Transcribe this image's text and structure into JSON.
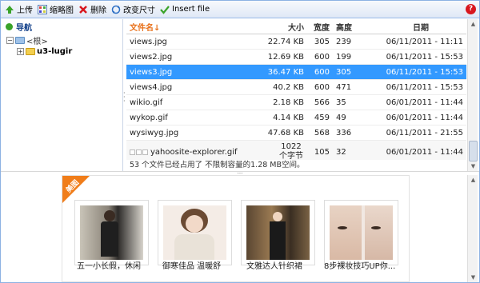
{
  "toolbar": {
    "items": [
      {
        "label": "上传",
        "icon": "upload-icon"
      },
      {
        "label": "缩略图",
        "icon": "thumbnail-icon"
      },
      {
        "label": "删除",
        "icon": "delete-icon"
      },
      {
        "label": "改变尺寸",
        "icon": "resize-icon"
      },
      {
        "label": "Insert file",
        "icon": "insert-file-icon"
      }
    ],
    "help_label": "?"
  },
  "nav": {
    "title": "导航",
    "tree": [
      {
        "label": "<根>",
        "toggle": "⊟"
      },
      {
        "label": "u3-lugir",
        "toggle": "⊞"
      }
    ]
  },
  "grid": {
    "headers": {
      "name": "文件名↓",
      "size": "大小",
      "width": "宽度",
      "height": "高度",
      "date": "日期"
    },
    "rows": [
      {
        "name": "views.jpg",
        "size": "22.74 KB",
        "w": "305",
        "h": "239",
        "date": "06/11/2011 - 11:11"
      },
      {
        "name": "views2.jpg",
        "size": "12.69 KB",
        "w": "600",
        "h": "199",
        "date": "06/11/2011 - 15:53"
      },
      {
        "name": "views3.jpg",
        "size": "36.47 KB",
        "w": "600",
        "h": "305",
        "date": "06/11/2011 - 15:53"
      },
      {
        "name": "views4.jpg",
        "size": "40.2 KB",
        "w": "600",
        "h": "471",
        "date": "06/11/2011 - 15:53"
      },
      {
        "name": "wikio.gif",
        "size": "2.18 KB",
        "w": "566",
        "h": "35",
        "date": "06/01/2011 - 11:44"
      },
      {
        "name": "wykop.gif",
        "size": "4.14 KB",
        "w": "459",
        "h": "49",
        "date": "06/01/2011 - 11:44"
      },
      {
        "name": "wysiwyg.jpg",
        "size": "47.68 KB",
        "w": "568",
        "h": "336",
        "date": "06/11/2011 - 21:55"
      },
      {
        "name": "yahoosite-explorer.gif",
        "size": "1022 个字节",
        "w": "105",
        "h": "32",
        "date": "06/01/2011 - 11:44"
      }
    ],
    "footer": "53 个文件已经占用了 不限制容量的1.28 MB空间。"
  },
  "preview": {
    "ribbon": "美图",
    "captions": [
      "五一小长假，休闲",
      "御寒佳品 温暖舒",
      "文雅达人针织裙",
      "8步裸妆技巧UP你..."
    ]
  },
  "colors": {
    "selection": "#3399ff",
    "header_text": "#e8701a",
    "ribbon": "#f07d1a"
  }
}
